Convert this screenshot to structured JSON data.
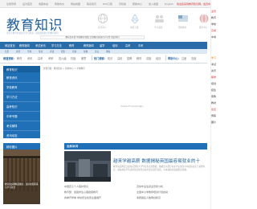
{
  "topbar": {
    "links": [
      "注册登录",
      "设为首页",
      "收藏本站",
      "繁體中文",
      "网站地图",
      "联系我们",
      "RSS订阅",
      "手机版",
      "帮助中心",
      "加入收藏",
      "English"
    ],
    "right_text": "欢迎您来到教育知识网，会员中心"
  },
  "header": {
    "logo": "教育知识",
    "slogan": "专注于教育知识的分享与交流，提供最新最全的教育资讯",
    "nav_icons": [
      {
        "label": "资讯中心",
        "icon": "globe-icon"
      },
      {
        "label": "资源下载",
        "icon": "recycle-icon"
      },
      {
        "label": "学习频道",
        "icon": "people-icon"
      },
      {
        "label": "国际教育",
        "icon": "flag-icon"
      },
      {
        "label": "服务中心",
        "icon": "globe-icon"
      }
    ],
    "notice": "教育部主管 中国教育在线 全国教育资源共享平台 欢迎访问"
  },
  "mainnav": {
    "items": [
      "网站首页",
      "教育新闻",
      "考试资讯",
      "学习方法",
      "教育",
      "教育新闻",
      "留学",
      "培训",
      "高考",
      "中考"
    ],
    "sub_items": [
      "首页",
      "资讯",
      "学校",
      "专业",
      "考试",
      "招生",
      "培训",
      "家教",
      "论坛",
      "博客"
    ]
  },
  "filter": {
    "label1": "频道搜索：",
    "group1": [
      "教育",
      "资讯",
      "高考",
      "考研",
      "四六级",
      "托福",
      "雅思"
    ],
    "label2": "热门搜索：",
    "group2": [
      "知识",
      "高校",
      "招聘",
      "教材",
      "讲座",
      "培训"
    ],
    "label3": "帮助中心：",
    "group3": [
      "注册",
      "充值"
    ]
  },
  "sidebar": {
    "title": "教育知识",
    "breadcrumb": "位置导航：教育知识 > 新闻中心 > 学校教育",
    "items": [
      "教育资讯",
      "学校教育",
      "学习方法",
      "高考知识",
      "中考专题",
      "考试辅导",
      "资讯动态"
    ]
  },
  "content": {
    "notice": "Couldn't load plugin."
  },
  "right_col": {
    "items": [
      {
        "text": "主管",
        "color": "red"
      },
      {
        "text": "教育",
        "color": "normal"
      },
      {
        "text": "学校",
        "color": "normal"
      },
      {
        "text": "高考",
        "color": "red"
      },
      {
        "text": "中考",
        "color": "normal"
      },
      {
        "text": "学习",
        "color": "orange"
      },
      {
        "text": "考试",
        "color": "normal"
      },
      {
        "text": "资讯",
        "color": "normal"
      },
      {
        "text": "留学",
        "color": "red"
      },
      {
        "text": "培训",
        "color": "normal"
      },
      {
        "text": "招生",
        "color": "normal"
      },
      {
        "text": "家教",
        "color": "normal"
      },
      {
        "text": "教材",
        "color": "normal"
      },
      {
        "text": "论坛",
        "color": "red"
      },
      {
        "text": "博客",
        "color": "normal"
      },
      {
        "text": "图片",
        "color": "normal"
      }
    ]
  },
  "photo_block": {
    "title": "精彩图片",
    "caption": "教育知识网精选图片，展示校园风采与学习生活"
  },
  "news": {
    "head": "公司新闻",
    "more": "更多>>",
    "headline": "越来学越高薪  数据揭秘英国最容易就业的十",
    "summary": "教育知识网近日发布英国各大学毕业生就业数据，数据显示部分专业毕业生的平均起薪远高于其他专业，越来越多学生选择就业前景良好的专业进行深造，为未来职业发展奠定基础。",
    "rows": [
      "中国孩子个人保护意识",
      "教育部：加强学生心理健康教育",
      "春季开学季 学校安全检查全面展开",
      "高校毕业生就业形势分析",
      "全国中小学教师培训计划启动",
      "考研报名人数再创新高"
    ]
  },
  "colors": {
    "brand": "#1f5f99",
    "nav": "#2a6ca8",
    "sidebar": "#1f70b7",
    "accent_red": "#cc2222"
  }
}
